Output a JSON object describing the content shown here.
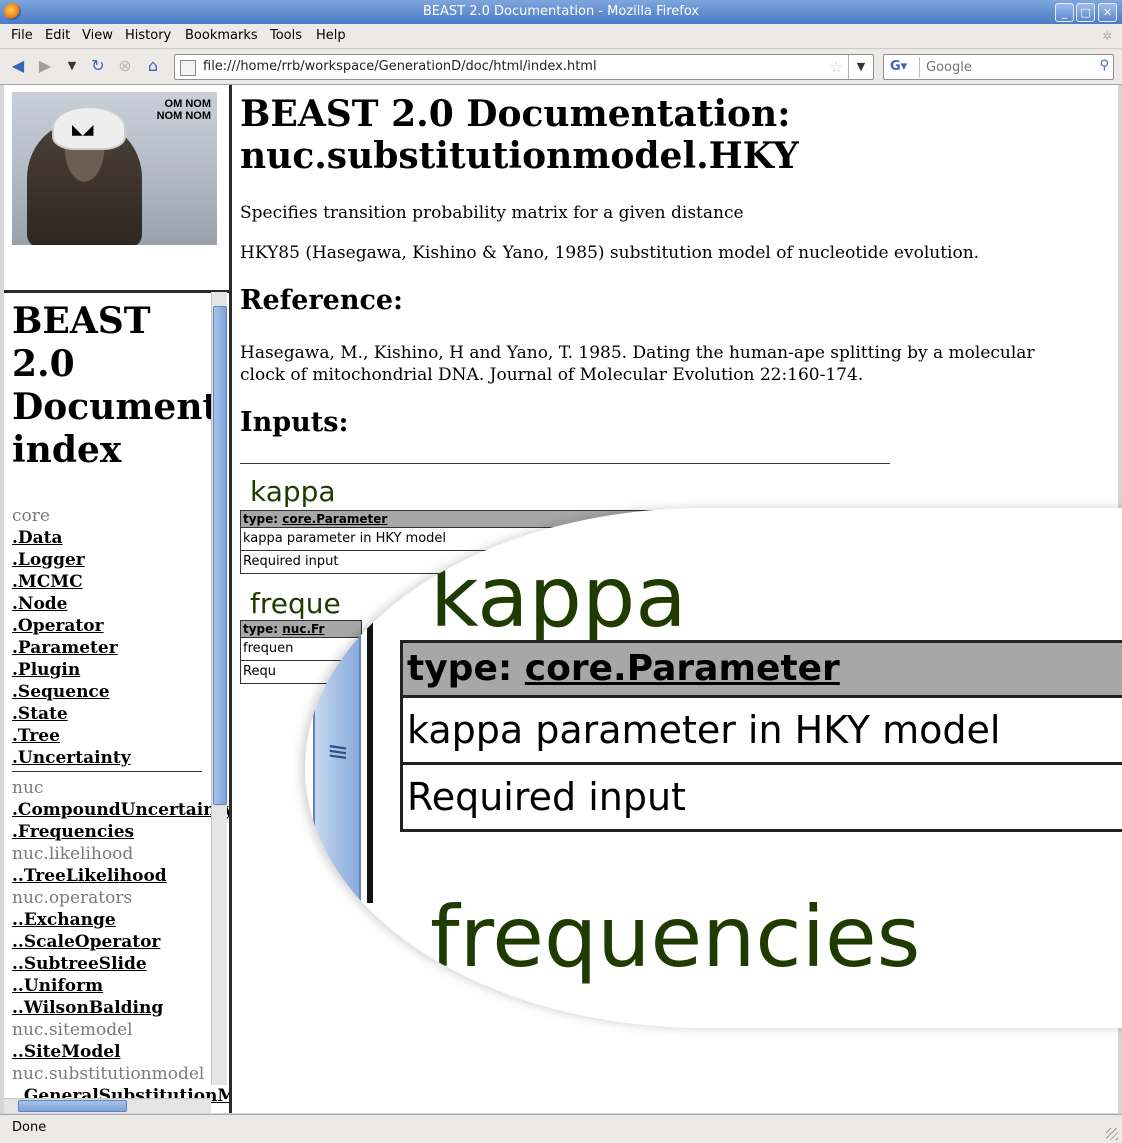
{
  "window": {
    "title": "BEAST 2.0 Documentation - Mozilla Firefox"
  },
  "menu": [
    "File",
    "Edit",
    "View",
    "History",
    "Bookmarks",
    "Tools",
    "Help"
  ],
  "nav": {
    "url": "file:///home/rrb/workspace/GenerationD/doc/html/index.html",
    "search_placeholder": "Google"
  },
  "logo": {
    "caption_line1": "OM NOM",
    "caption_line2": "NOM NOM"
  },
  "index": {
    "heading_lines": [
      "BEAST",
      "2.0",
      "Documentation",
      "index"
    ],
    "entries": [
      {
        "text": "core",
        "kind": "pkg"
      },
      {
        "text": ".Data",
        "kind": "link"
      },
      {
        "text": ".Logger",
        "kind": "link"
      },
      {
        "text": ".MCMC",
        "kind": "link"
      },
      {
        "text": ".Node",
        "kind": "link"
      },
      {
        "text": ".Operator",
        "kind": "link"
      },
      {
        "text": ".Parameter",
        "kind": "link"
      },
      {
        "text": ".Plugin",
        "kind": "link"
      },
      {
        "text": ".Sequence",
        "kind": "link"
      },
      {
        "text": ".State",
        "kind": "link"
      },
      {
        "text": ".Tree",
        "kind": "link"
      },
      {
        "text": ".Uncertainty",
        "kind": "link"
      },
      {
        "text": "nuc",
        "kind": "pkg"
      },
      {
        "text": ".CompoundUncertainty",
        "kind": "link"
      },
      {
        "text": ".Frequencies",
        "kind": "link"
      },
      {
        "text": "nuc.likelihood",
        "kind": "pkg"
      },
      {
        "text": "..TreeLikelihood",
        "kind": "link"
      },
      {
        "text": "nuc.operators",
        "kind": "pkg"
      },
      {
        "text": "..Exchange",
        "kind": "link"
      },
      {
        "text": "..ScaleOperator",
        "kind": "link"
      },
      {
        "text": "..SubtreeSlide",
        "kind": "link"
      },
      {
        "text": "..Uniform",
        "kind": "link"
      },
      {
        "text": "..WilsonBalding",
        "kind": "link"
      },
      {
        "text": "nuc.sitemodel",
        "kind": "pkg"
      },
      {
        "text": "..SiteModel",
        "kind": "link"
      },
      {
        "text": "nuc.substitutionmodel",
        "kind": "pkg"
      },
      {
        "text": "..GeneralSubstitutionModel",
        "kind": "link"
      }
    ]
  },
  "main": {
    "title_line1": "BEAST 2.0 Documentation:",
    "title_line2": "nuc.substitutionmodel.HKY",
    "desc1": "Specifies transition probability matrix for a given distance",
    "desc2": "HKY85 (Hasegawa, Kishino & Yano, 1985) substitution model of nucleotide evolution.",
    "reference_heading": "Reference:",
    "reference_line1": "Hasegawa, M., Kishino, H and Yano, T. 1985. Dating the human-ape splitting by a molecular",
    "reference_line2": "clock of mitochondrial DNA. Journal of Molecular Evolution 22:160-174.",
    "inputs_heading": "Inputs:",
    "inputs": [
      {
        "name": "kappa",
        "type_prefix": "type: ",
        "type": "core.Parameter",
        "desc": "kappa parameter in HKY model",
        "req": "Required input"
      },
      {
        "name": "frequencies",
        "type_prefix": "type: ",
        "type": "nuc.Fr",
        "desc": "frequen",
        "req": "Requ"
      }
    ],
    "frequencies_label": "freque"
  },
  "magnifier": {
    "name": "kappa",
    "type_prefix": "type: ",
    "type": "core.Parameter",
    "desc": "kappa parameter in HKY model",
    "req": "Required input",
    "next_name": "frequencies"
  },
  "status": {
    "text": "Done"
  }
}
